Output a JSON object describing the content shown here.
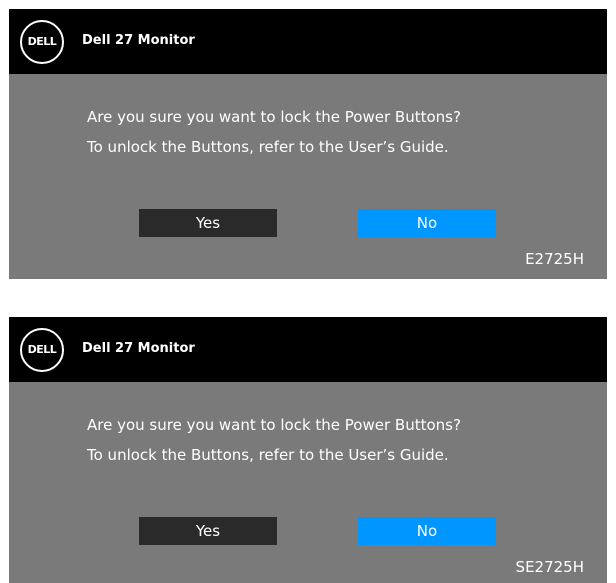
{
  "dialogs": [
    {
      "logo_text": "DELL",
      "title": "Dell 27 Monitor",
      "message_line1": "Are you sure you want to lock the Power Buttons?",
      "message_line2": "To unlock the Buttons, refer to the User’s Guide.",
      "yes_label": "Yes",
      "no_label": "No",
      "model": "E2725H",
      "selected": "No"
    },
    {
      "logo_text": "DELL",
      "title": "Dell 27 Monitor",
      "message_line1": "Are you sure you want to lock the Power Buttons?",
      "message_line2": "To unlock the Buttons, refer to the User’s Guide.",
      "yes_label": "Yes",
      "no_label": "No",
      "model": "SE2725H",
      "selected": "No"
    }
  ],
  "colors": {
    "titlebar": "#000000",
    "panel": "#7a7a7a",
    "button_default": "#2a2a2a",
    "button_selected": "#0096ff",
    "text": "#ffffff"
  }
}
